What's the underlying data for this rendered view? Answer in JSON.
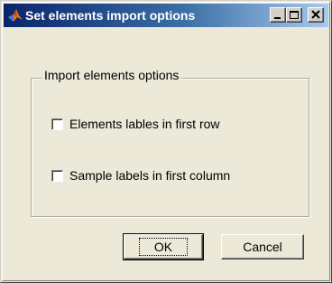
{
  "window": {
    "title": "Set elements import options",
    "icon": "matlab-icon"
  },
  "titlebar_buttons": {
    "minimize_icon": "minimize-icon",
    "maximize_icon": "maximize-icon",
    "close_icon": "close-icon"
  },
  "group": {
    "label": "Import elements options",
    "options": [
      {
        "label": "Elements lables in first row",
        "checked": false
      },
      {
        "label": "Sample labels in first column",
        "checked": false
      }
    ]
  },
  "buttons": {
    "ok_label": "OK",
    "cancel_label": "Cancel"
  }
}
